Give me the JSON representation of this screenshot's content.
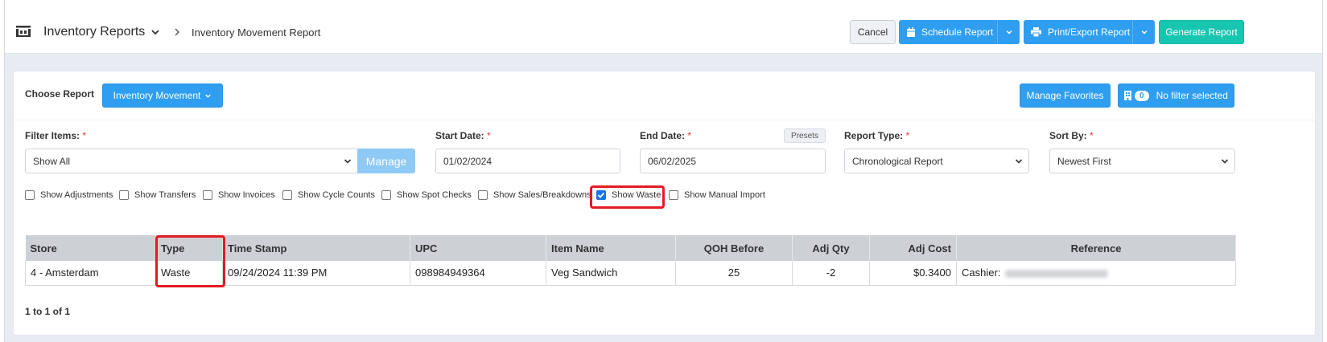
{
  "header": {
    "title": "Inventory Reports",
    "breadcrumb": "Inventory Movement Report",
    "cancel_label": "Cancel",
    "schedule_label": "Schedule Report",
    "print_label": "Print/Export Report",
    "generate_label": "Generate Report"
  },
  "report": {
    "choose_label": "Choose Report",
    "selected": "Inventory Movement",
    "manage_favorites": "Manage Favorites",
    "filter_count": "0",
    "no_filter": "No filter selected"
  },
  "filters": {
    "filter_items": {
      "label": "Filter Items:",
      "value": "Show All",
      "manage": "Manage"
    },
    "start_date": {
      "label": "Start Date:",
      "value": "01/02/2024"
    },
    "end_date": {
      "label": "End Date:",
      "value": "06/02/2025",
      "presets": "Presets"
    },
    "report_type": {
      "label": "Report Type:",
      "value": "Chronological Report"
    },
    "sort_by": {
      "label": "Sort By:",
      "value": "Newest First"
    },
    "required_mark": "*"
  },
  "checkboxes": [
    {
      "label": "Show Adjustments",
      "checked": false
    },
    {
      "label": "Show Transfers",
      "checked": false
    },
    {
      "label": "Show Invoices",
      "checked": false
    },
    {
      "label": "Show Cycle Counts",
      "checked": false
    },
    {
      "label": "Show Spot Checks",
      "checked": false
    },
    {
      "label": "Show Sales/Breakdowns",
      "checked": false
    },
    {
      "label": "Show Waste",
      "checked": true
    },
    {
      "label": "Show Manual Import",
      "checked": false
    }
  ],
  "table": {
    "columns": [
      "Store",
      "Type",
      "Time Stamp",
      "UPC",
      "Item Name",
      "QOH Before",
      "Adj Qty",
      "Adj Cost",
      "Reference"
    ],
    "rows": [
      {
        "store": "4 - Amsterdam",
        "type": "Waste",
        "timestamp": "09/24/2024 11:39 PM",
        "upc": "098984949364",
        "item_name": "Veg Sandwich",
        "qoh_before": "25",
        "adj_qty": "-2",
        "adj_cost": "$0.3400",
        "reference": "Cashier:"
      }
    ]
  },
  "pagination": "1 to 1 of 1",
  "colors": {
    "primary": "#2f9ef0",
    "teal": "#18c6b0",
    "highlight": "#e31b23",
    "table_header": "#cdd0d5"
  }
}
